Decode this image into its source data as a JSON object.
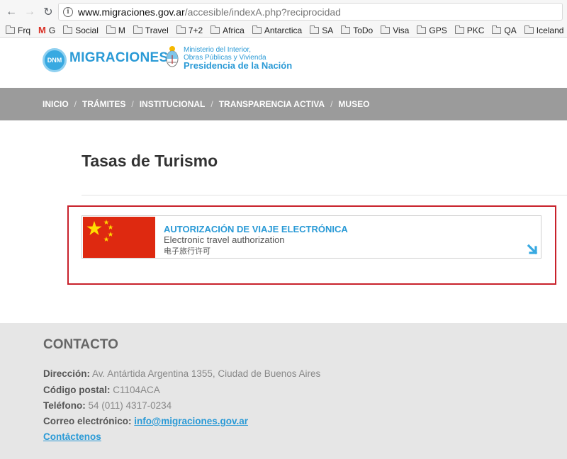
{
  "browser": {
    "url_domain": "www.migraciones.gov.ar",
    "url_path": "/accesible/indexA.php?reciprocidad",
    "back_icon": "←",
    "forward_icon": "→",
    "reload_icon": "↻",
    "info_icon": "i",
    "bookmarks": [
      "Frq",
      "G",
      "Social",
      "M",
      "Travel",
      "7+2",
      "Africa",
      "Antarctica",
      "SA",
      "ToDo",
      "Visa",
      "GPS",
      "PKC",
      "QA",
      "Iceland"
    ]
  },
  "header": {
    "logo_badge": "DNM",
    "logo_text": "MIGRACIONES",
    "ministerio_line1": "Ministerio del Interior,",
    "ministerio_line2": "Obras Públicas y Vivienda",
    "presidencia": "Presidencia de la Nación"
  },
  "nav": {
    "items": [
      "INICIO",
      "TRÁMITES",
      "INSTITUCIONAL",
      "TRANSPARENCIA ACTIVA",
      "MUSEO"
    ],
    "separator": "/"
  },
  "main": {
    "title": "Tasas de Turismo",
    "card": {
      "title": "AUTORIZACIÓN DE VIAJE ELECTRÓNICA",
      "subtitle_en": "Electronic travel authorization",
      "subtitle_zh": "电子旅行许可"
    }
  },
  "footer": {
    "title": "CONTACTO",
    "direccion_label": "Dirección:",
    "direccion_value": "Av. Antártida Argentina 1355, Ciudad de Buenos Aires",
    "cp_label": "Código postal:",
    "cp_value": "C1104ACA",
    "tel_label": "Teléfono:",
    "tel_value": "54 (011) 4317-0234",
    "email_label": "Correo electrónico:",
    "email_value": "info@migraciones.gov.ar",
    "contact_link": "Contáctenos"
  },
  "colors": {
    "brand_blue": "#2a9ad6",
    "nav_grey": "#9b9b9b",
    "highlight_red": "#c8212b",
    "flag_red": "#de2910",
    "flag_yellow": "#ffde00"
  }
}
